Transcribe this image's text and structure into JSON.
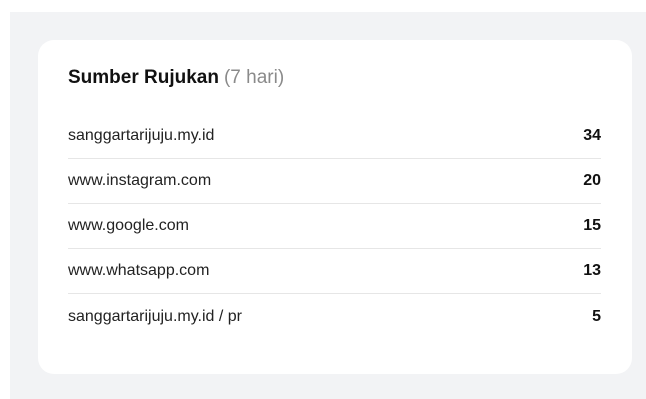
{
  "card": {
    "title": "Sumber Rujukan",
    "period": "(7 hari)"
  },
  "referrers": [
    {
      "domain": "sanggartarijuju.my.id",
      "count": "34"
    },
    {
      "domain": "www.instagram.com",
      "count": "20"
    },
    {
      "domain": "www.google.com",
      "count": "15"
    },
    {
      "domain": "www.whatsapp.com",
      "count": "13"
    },
    {
      "domain": "sanggartarijuju.my.id / pr",
      "count": "5"
    }
  ]
}
